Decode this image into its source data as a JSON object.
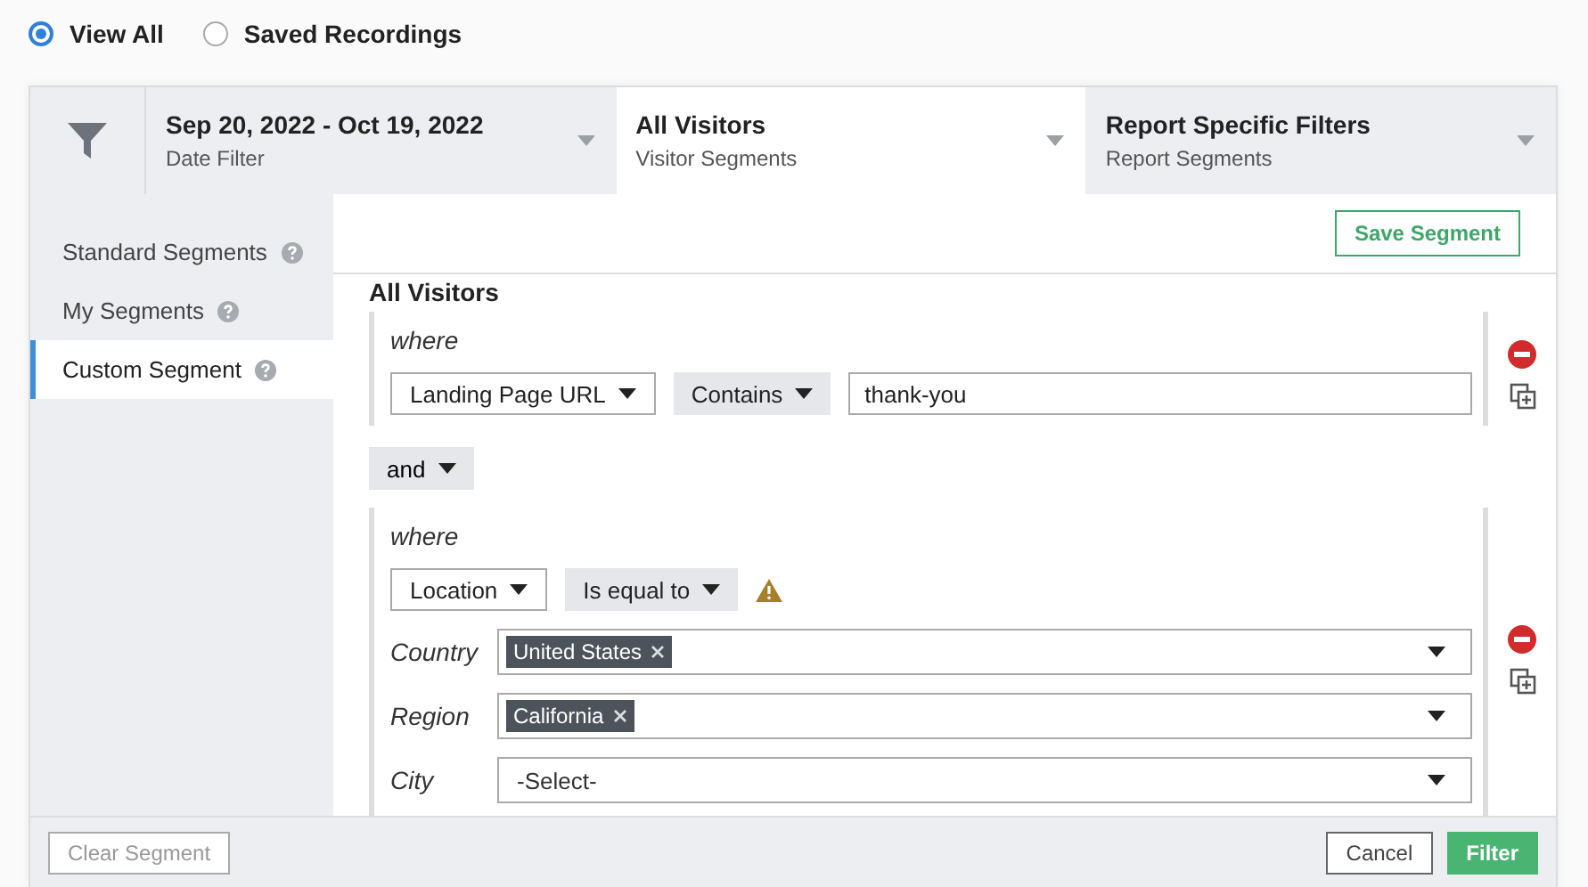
{
  "view_options": [
    {
      "label": "View All",
      "selected": true
    },
    {
      "label": "Saved Recordings",
      "selected": false
    }
  ],
  "tabs": [
    {
      "title": "Sep 20, 2022 - Oct 19, 2022",
      "subtitle": "Date Filter",
      "selected": false
    },
    {
      "title": "All Visitors",
      "subtitle": "Visitor Segments",
      "selected": true
    },
    {
      "title": "Report Specific Filters",
      "subtitle": "Report Segments",
      "selected": false
    }
  ],
  "sidebar": {
    "items": [
      {
        "label": "Standard Segments",
        "selected": false
      },
      {
        "label": "My Segments",
        "selected": false
      },
      {
        "label": "Custom Segment",
        "selected": true
      }
    ]
  },
  "save_button": "Save Segment",
  "segment": {
    "title": "All Visitors",
    "groups": [
      {
        "where": "where",
        "field": "Landing Page URL",
        "operator": "Contains",
        "warning": false,
        "value": "thank-you"
      },
      {
        "where": "where",
        "field": "Location",
        "operator": "Is equal to",
        "warning": true,
        "filters": [
          {
            "label": "Country",
            "tags": [
              "United States"
            ]
          },
          {
            "label": "Region",
            "tags": [
              "California"
            ]
          },
          {
            "label": "City",
            "placeholder": "-Select-"
          }
        ]
      }
    ],
    "joiner": "and"
  },
  "footer": {
    "clear_button": {
      "label": "Clear Segment",
      "disabled": true
    },
    "cancel_button": "Cancel",
    "filter_button": "Filter"
  }
}
